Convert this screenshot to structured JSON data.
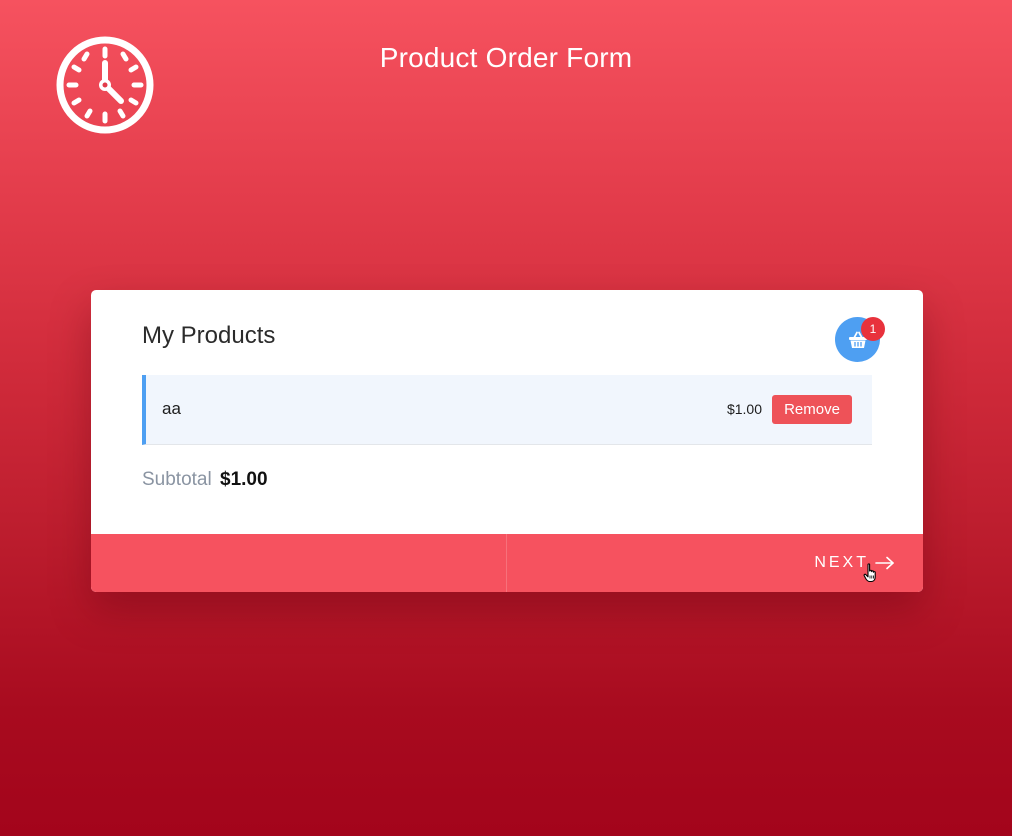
{
  "header": {
    "title": "Product Order Form",
    "logo_icon": "clock-icon"
  },
  "card": {
    "title": "My Products",
    "cart": {
      "icon": "basket-icon",
      "count": "1",
      "color": "#4e9ff2",
      "count_color": "#e8323c"
    },
    "products": [
      {
        "name": "aa",
        "price": "$1.00",
        "remove_label": "Remove"
      }
    ],
    "subtotal": {
      "label": "Subtotal",
      "value": "$1.00"
    }
  },
  "footer": {
    "next_label": "NEXT",
    "next_icon": "arrow-right-icon",
    "accent": "#f6525f"
  }
}
